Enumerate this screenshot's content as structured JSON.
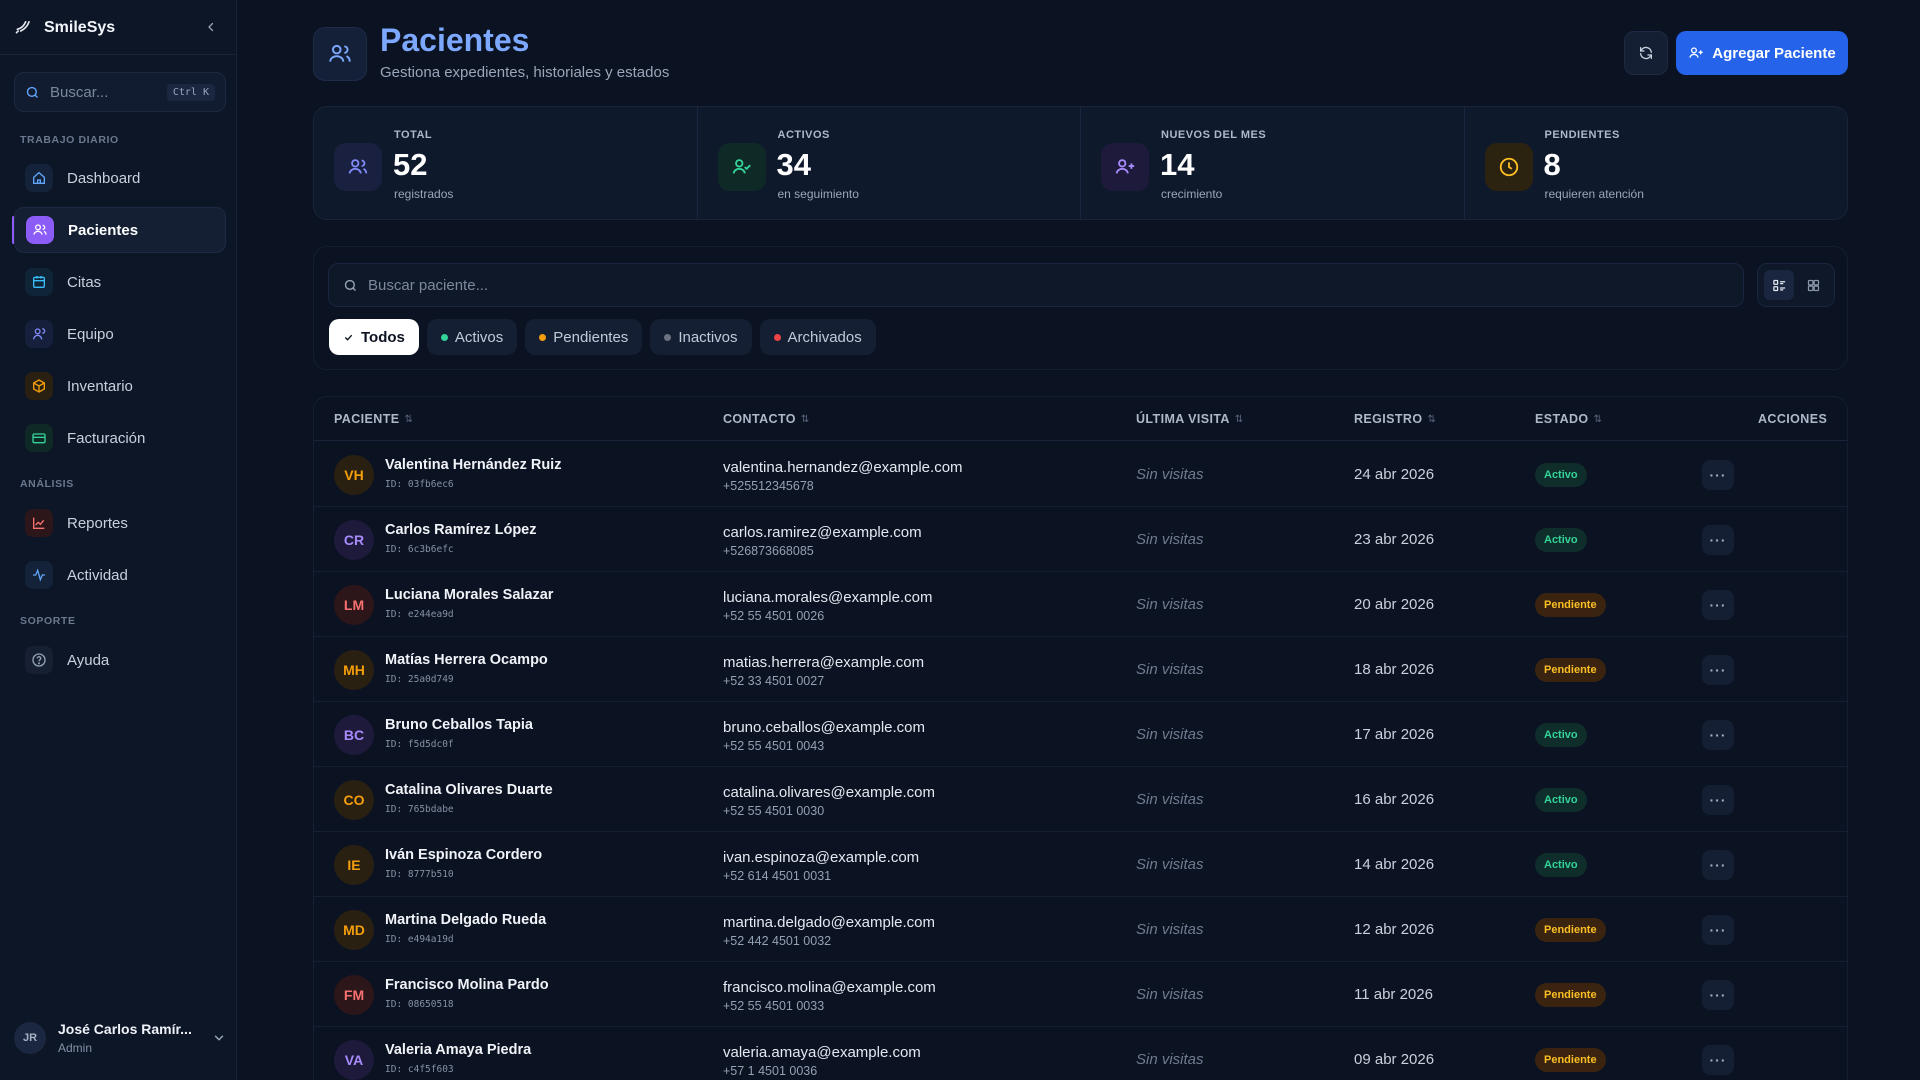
{
  "app": {
    "brand": "SmileSys"
  },
  "sidebar": {
    "search": {
      "placeholder": "Buscar...",
      "shortcut": "Ctrl K"
    },
    "sections": [
      {
        "label": "TRABAJO DIARIO"
      },
      {
        "label": "ANÁLISIS"
      },
      {
        "label": "SOPORTE"
      }
    ],
    "items": [
      {
        "label": "Dashboard",
        "icon": "home-icon",
        "color": "#60a5fa"
      },
      {
        "label": "Pacientes",
        "icon": "users-icon",
        "color": "#a78bfa",
        "active": true
      },
      {
        "label": "Citas",
        "icon": "calendar-icon",
        "color": "#38bdf8"
      },
      {
        "label": "Equipo",
        "icon": "team-icon",
        "color": "#818cf8"
      },
      {
        "label": "Inventario",
        "icon": "box-icon",
        "color": "#f59e0b"
      },
      {
        "label": "Facturación",
        "icon": "card-icon",
        "color": "#34d399"
      },
      {
        "label": "Reportes",
        "icon": "chart-icon",
        "color": "#f87171"
      },
      {
        "label": "Actividad",
        "icon": "activity-icon",
        "color": "#60a5fa"
      },
      {
        "label": "Ayuda",
        "icon": "help-icon",
        "color": "#94a3b8"
      }
    ],
    "user": {
      "initials": "JR",
      "name": "José Carlos Ramír...",
      "role": "Admin"
    }
  },
  "header": {
    "title": "Pacientes",
    "subtitle": "Gestiona expedientes, historiales y estados",
    "add_label": "Agregar Paciente"
  },
  "stats": [
    {
      "label": "TOTAL",
      "value": "52",
      "sub": "registrados",
      "icon": "users-icon",
      "color": "#818cf8"
    },
    {
      "label": "ACTIVOS",
      "value": "34",
      "sub": "en seguimiento",
      "icon": "user-check-icon",
      "color": "#34d399"
    },
    {
      "label": "NUEVOS DEL MES",
      "value": "14",
      "sub": "crecimiento",
      "icon": "user-plus-icon",
      "color": "#a78bfa"
    },
    {
      "label": "PENDIENTES",
      "value": "8",
      "sub": "requieren atención",
      "icon": "clock-icon",
      "color": "#fbbf24"
    }
  ],
  "filters": {
    "search_placeholder": "Buscar paciente...",
    "chips": [
      {
        "label": "Todos",
        "active": true
      },
      {
        "label": "Activos",
        "dot": "#34d399"
      },
      {
        "label": "Pendientes",
        "dot": "#f59e0b"
      },
      {
        "label": "Inactivos",
        "dot": "#6b7280"
      },
      {
        "label": "Archivados",
        "dot": "#ef4444"
      }
    ]
  },
  "table": {
    "columns": [
      "PACIENTE",
      "CONTACTO",
      "ÚLTIMA VISITA",
      "REGISTRO",
      "ESTADO",
      "ACCIONES"
    ],
    "rows": [
      {
        "initials": "VH",
        "name": "Valentina Hernández Ruiz",
        "id": "ID: 03fb6ec6",
        "email": "valentina.hernandez@example.com",
        "phone": "+525512345678",
        "visit": "Sin visitas",
        "date": "24 abr 2026",
        "status": "Activo",
        "color": "#f59e0b"
      },
      {
        "initials": "CR",
        "name": "Carlos Ramírez López",
        "id": "ID: 6c3b6efc",
        "email": "carlos.ramirez@example.com",
        "phone": "+526873668085",
        "visit": "Sin visitas",
        "date": "23 abr 2026",
        "status": "Activo",
        "color": "#a78bfa"
      },
      {
        "initials": "LM",
        "name": "Luciana Morales Salazar",
        "id": "ID: e244ea9d",
        "email": "luciana.morales@example.com",
        "phone": "+52 55 4501 0026",
        "visit": "Sin visitas",
        "date": "20 abr 2026",
        "status": "Pendiente",
        "color": "#f87171"
      },
      {
        "initials": "MH",
        "name": "Matías Herrera Ocampo",
        "id": "ID: 25a0d749",
        "email": "matias.herrera@example.com",
        "phone": "+52 33 4501 0027",
        "visit": "Sin visitas",
        "date": "18 abr 2026",
        "status": "Pendiente",
        "color": "#f59e0b"
      },
      {
        "initials": "BC",
        "name": "Bruno Ceballos Tapia",
        "id": "ID: f5d5dc0f",
        "email": "bruno.ceballos@example.com",
        "phone": "+52 55 4501 0043",
        "visit": "Sin visitas",
        "date": "17 abr 2026",
        "status": "Activo",
        "color": "#a78bfa"
      },
      {
        "initials": "CO",
        "name": "Catalina Olivares Duarte",
        "id": "ID: 765bdabe",
        "email": "catalina.olivares@example.com",
        "phone": "+52 55 4501 0030",
        "visit": "Sin visitas",
        "date": "16 abr 2026",
        "status": "Activo",
        "color": "#f59e0b"
      },
      {
        "initials": "IE",
        "name": "Iván Espinoza Cordero",
        "id": "ID: 8777b510",
        "email": "ivan.espinoza@example.com",
        "phone": "+52 614 4501 0031",
        "visit": "Sin visitas",
        "date": "14 abr 2026",
        "status": "Activo",
        "color": "#f59e0b"
      },
      {
        "initials": "MD",
        "name": "Martina Delgado Rueda",
        "id": "ID: e494a19d",
        "email": "martina.delgado@example.com",
        "phone": "+52 442 4501 0032",
        "visit": "Sin visitas",
        "date": "12 abr 2026",
        "status": "Pendiente",
        "color": "#f59e0b"
      },
      {
        "initials": "FM",
        "name": "Francisco Molina Pardo",
        "id": "ID: 08650518",
        "email": "francisco.molina@example.com",
        "phone": "+52 55 4501 0033",
        "visit": "Sin visitas",
        "date": "11 abr 2026",
        "status": "Pendiente",
        "color": "#f87171"
      },
      {
        "initials": "VA",
        "name": "Valeria Amaya Piedra",
        "id": "ID: c4f5f603",
        "email": "valeria.amaya@example.com",
        "phone": "+57 1 4501 0036",
        "visit": "Sin visitas",
        "date": "09 abr 2026",
        "status": "Pendiente",
        "color": "#a78bfa"
      }
    ]
  }
}
